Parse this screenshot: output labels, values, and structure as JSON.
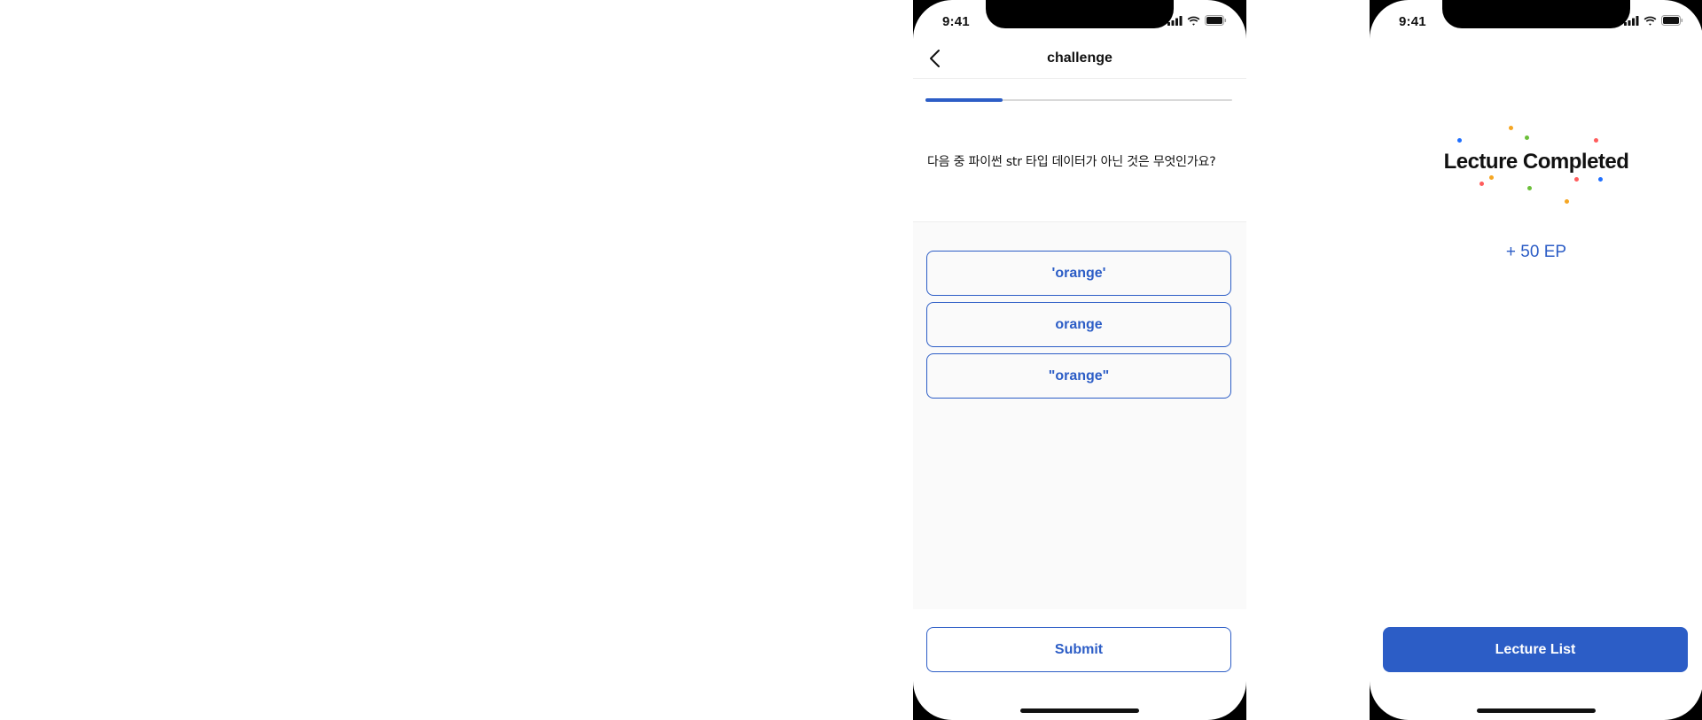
{
  "colors": {
    "accent": "#2c5dc6",
    "confetti": [
      "#1f6fff",
      "#f5a623",
      "#6cbf3a",
      "#ff5c5c",
      "#f5a623",
      "#1f6fff",
      "#ff5c5c",
      "#6cbf3a",
      "#ff5c5c",
      "#f5a623"
    ]
  },
  "challenge_screen": {
    "status": {
      "time": "9:41",
      "icons": [
        "signal-icon",
        "wifi-icon",
        "battery-icon"
      ]
    },
    "nav": {
      "title": "challenge",
      "back_icon": "chevron-left-icon"
    },
    "progress": {
      "fraction": 0.25
    },
    "question": "다음 중 파이썬 str 타입 데이터가 아닌 것은 무엇인가요?",
    "options": [
      "'orange'",
      "orange",
      "\"orange\""
    ],
    "submit_label": "Submit"
  },
  "completed_screen": {
    "status": {
      "time": "9:41",
      "icons": [
        "signal-icon",
        "wifi-icon",
        "battery-icon"
      ]
    },
    "title": "Lecture Completed",
    "reward": "+ 50 EP",
    "button_label": "Lecture List"
  }
}
